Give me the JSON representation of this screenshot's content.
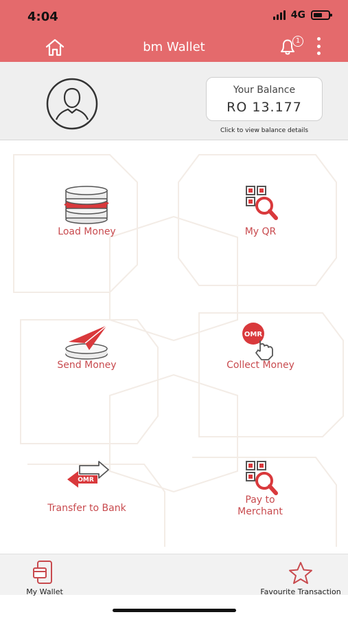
{
  "status_bar": {
    "time": "4:04",
    "network": "4G"
  },
  "nav": {
    "title": "bm Wallet",
    "notification_count": "1"
  },
  "balance": {
    "label": "Your Balance",
    "value": "RO 13.177",
    "hint": "Click to view balance details"
  },
  "tiles": [
    {
      "label": "Load Money",
      "icon": "coins-stack-icon"
    },
    {
      "label": "My QR",
      "icon": "qr-search-icon"
    },
    {
      "label": "Send Money",
      "icon": "paper-plane-icon"
    },
    {
      "label": "Collect Money",
      "icon": "omr-tap-icon"
    },
    {
      "label": "Transfer to Bank",
      "icon": "omr-exchange-arrows-icon"
    },
    {
      "label": "Pay to Merchant",
      "icon": "qr-search-icon"
    }
  ],
  "tile_icon_text": {
    "omr": "OMR"
  },
  "bottom_nav": {
    "wallet_label": "My Wallet",
    "favourite_label": "Favourite Transaction"
  },
  "colors": {
    "brand": "#e46a6c",
    "label": "#c84a4e",
    "accent": "#d9393c"
  }
}
